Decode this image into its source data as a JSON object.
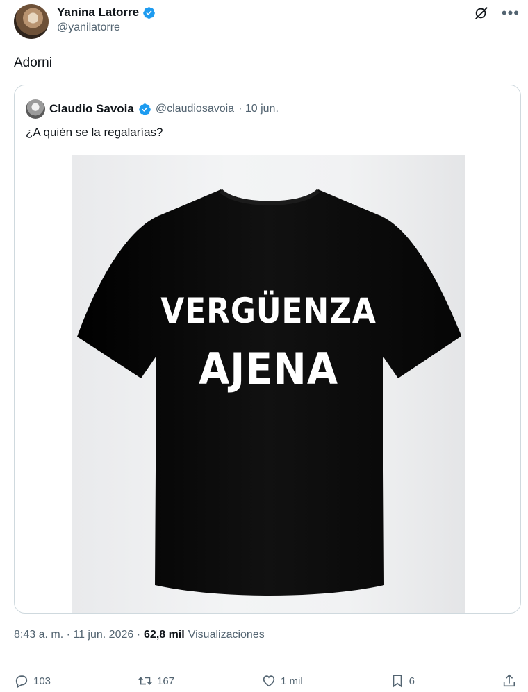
{
  "author": {
    "name": "Yanina Latorre",
    "handle": "@yanilatorre"
  },
  "tweet": {
    "text": "Adorni"
  },
  "quoted": {
    "name": "Claudio Savoia",
    "handle": "@claudiosavoia",
    "date": "· 10 jun.",
    "text": "¿A quién se la regalarías?",
    "image_text": {
      "line1": "VERGÜENZA",
      "line2": "AJENA"
    }
  },
  "meta": {
    "time": "8:43 a. m. · 11 jun. 2026 ·",
    "views": "62,8 mil",
    "views_label": "Visualizaciones"
  },
  "actions": {
    "replies": "103",
    "reposts": "167",
    "likes": "1 mil",
    "bookmarks": "6"
  },
  "colors": {
    "verified": "#1d9bf0",
    "secondary": "#536471",
    "border": "#cfd9de"
  },
  "icons": [
    "verified-icon",
    "grok-icon",
    "more-icon",
    "reply-icon",
    "repost-icon",
    "like-icon",
    "bookmark-icon",
    "share-icon"
  ]
}
